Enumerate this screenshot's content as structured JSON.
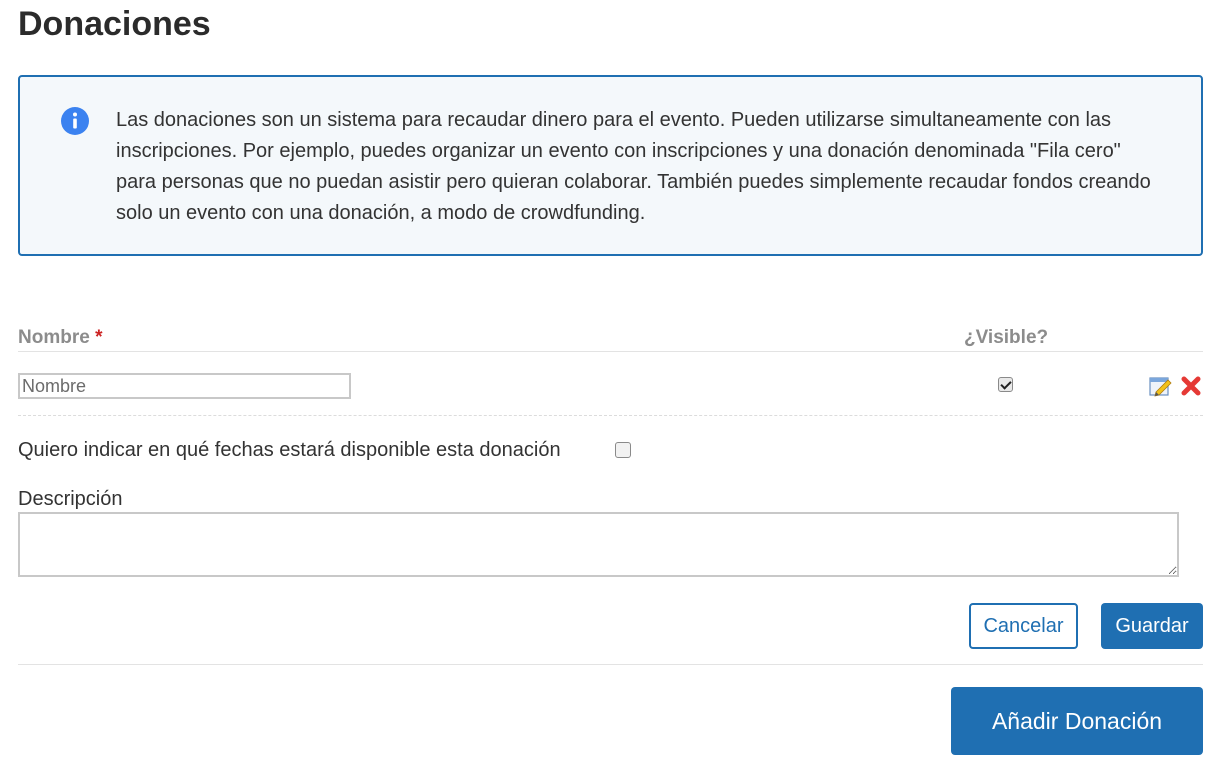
{
  "page": {
    "title": "Donaciones"
  },
  "info": {
    "icon": "info-icon",
    "text": "Las donaciones son un sistema para recaudar dinero para el evento. Pueden utilizarse simultaneamente con las inscripciones. Por ejemplo, puedes organizar un evento con inscripciones y una donación denominada \"Fila cero\" para personas que no puedan asistir pero quieran colaborar. También puedes simplemente recaudar fondos creando solo un evento con una donación, a modo de crowdfunding."
  },
  "table": {
    "headers": {
      "name": "Nombre",
      "required_marker": "*",
      "visible": "¿Visible?"
    },
    "row": {
      "name_placeholder": "Nombre",
      "name_value": "",
      "visible_checked": true,
      "edit_icon": "edit-icon",
      "delete_icon": "delete-icon"
    }
  },
  "dates": {
    "label": "Quiero indicar en qué fechas estará disponible esta donación",
    "checked": false
  },
  "description": {
    "label": "Descripción",
    "value": ""
  },
  "actions": {
    "cancel": "Cancelar",
    "save": "Guardar",
    "add": "Añadir Donación"
  },
  "colors": {
    "primary": "#1f6fb2",
    "info_bg": "#f4f8fb",
    "required": "#cc2222",
    "delete": "#e53935"
  }
}
